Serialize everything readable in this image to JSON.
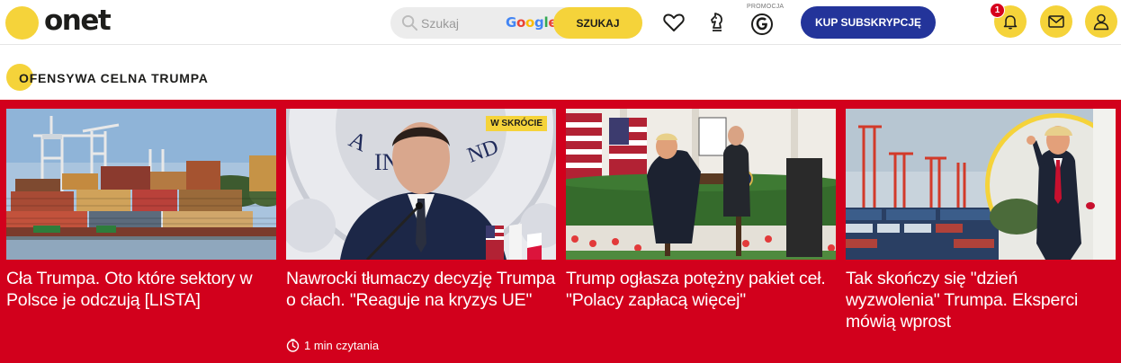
{
  "header": {
    "logo_text": "onet",
    "search": {
      "placeholder": "Szukaj",
      "provider": "Google",
      "button_label": "SZUKAJ"
    },
    "promo_label": "PROMOCJA",
    "subscribe_label": "KUP SUBSKRYPCJĘ",
    "notifications_count": "1"
  },
  "section": {
    "title": "OFENSYWA CELNA TRUMPA"
  },
  "cards": [
    {
      "title": "Cła Trumpa. Oto które sektory w Polsce je odczują [LISTA]"
    },
    {
      "title": "Nawrocki tłumaczy decyzję Trumpa o cłach. \"Reaguje na kryzys UE\"",
      "badge": "W SKRÓCIE",
      "read_time": "1 min czytania"
    },
    {
      "title": "Trump ogłasza potężny pakiet ceł. \"Polacy zapłacą więcej\""
    },
    {
      "title": "Tak skończy się \"dzień wyzwolenia\" Trumpa. Eksperci mówią wprost"
    }
  ],
  "colors": {
    "brand_yellow": "#f5d33a",
    "band_red": "#d2001c",
    "subscribe_blue": "#23349a"
  },
  "icons": [
    "search-icon",
    "heart-icon",
    "chess-knight-icon",
    "g-promo-icon",
    "bell-icon",
    "mail-icon",
    "user-icon",
    "clock-icon"
  ]
}
